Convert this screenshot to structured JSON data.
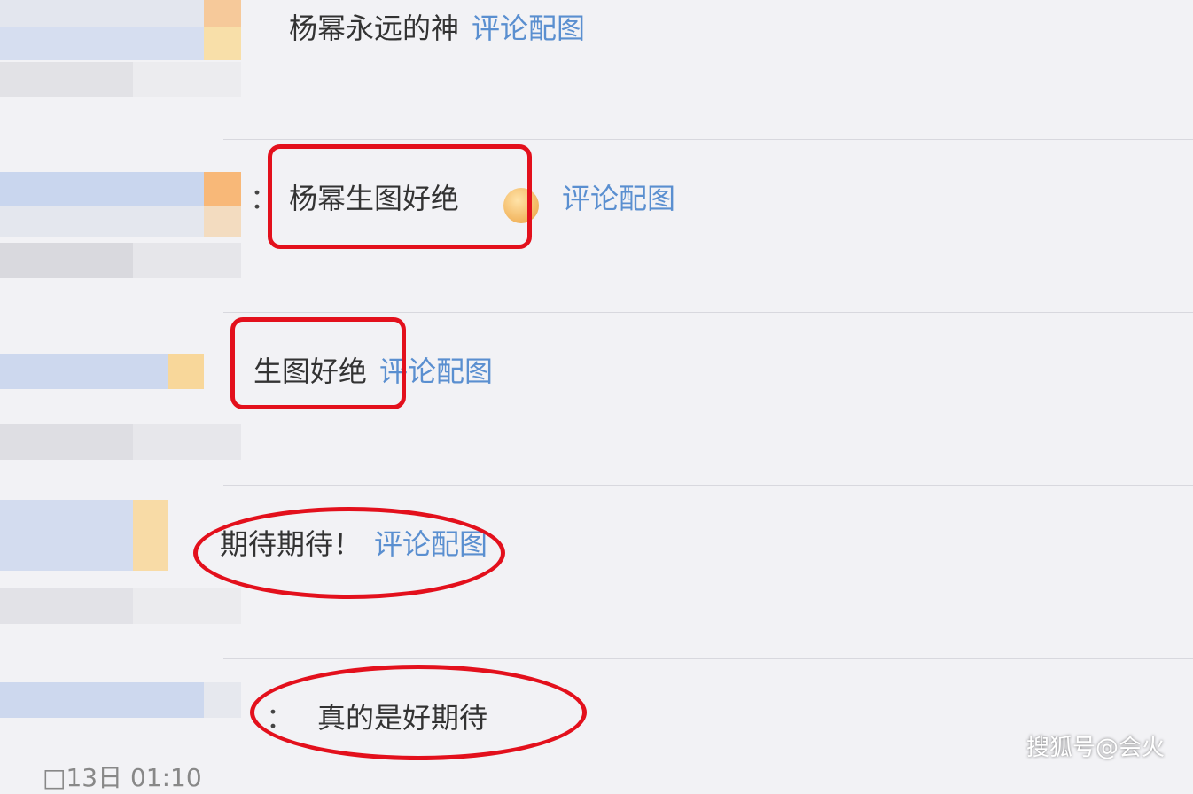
{
  "comments": [
    {
      "text": "杨幂永远的神",
      "link": "评论配图"
    },
    {
      "text": "杨幂生图好绝",
      "link": "评论配图"
    },
    {
      "text": "生图好绝",
      "link": "评论配图"
    },
    {
      "text": "期待期待！",
      "link": "评论配图"
    },
    {
      "text": "真的是好期待",
      "link": ""
    }
  ],
  "separators": {
    "colon": "："
  },
  "timestamp": "□13日 01:10",
  "watermark": "搜狐号@会火",
  "colors": {
    "highlight": "#e3101c",
    "link": "#5a8fd0"
  },
  "icons": [
    "emoji-face-icon"
  ]
}
